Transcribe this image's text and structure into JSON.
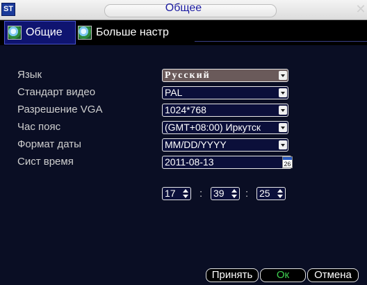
{
  "window": {
    "logo": "ST",
    "title": "Общее"
  },
  "tabs": [
    {
      "label": "Общие",
      "active": true
    },
    {
      "label": "Больше настр",
      "active": false
    }
  ],
  "settings": {
    "language": {
      "label": "Язык",
      "value": "Русский"
    },
    "video_standard": {
      "label": "Стандарт видео",
      "value": "PAL"
    },
    "vga_resolution": {
      "label": "Разрешение VGA",
      "value": "1024*768"
    },
    "time_zone": {
      "label": "Час пояс",
      "value": "(GMT+08:00) Иркутск"
    },
    "date_format": {
      "label": "Формат даты",
      "value": "MM/DD/YYYY"
    },
    "system_time": {
      "label": "Сист время",
      "date": "2011-08-13",
      "calendar_day": "26"
    },
    "time": {
      "hours": "17",
      "minutes": "39",
      "seconds": "25",
      "separator": ":"
    }
  },
  "buttons": {
    "apply": "Принять",
    "ok": "Ок",
    "cancel": "Отмена"
  },
  "colors": {
    "background": "#0a0e24",
    "active_tab": "#0f1470",
    "ok_text": "#3fd050",
    "title_text": "#1a1aa0"
  }
}
